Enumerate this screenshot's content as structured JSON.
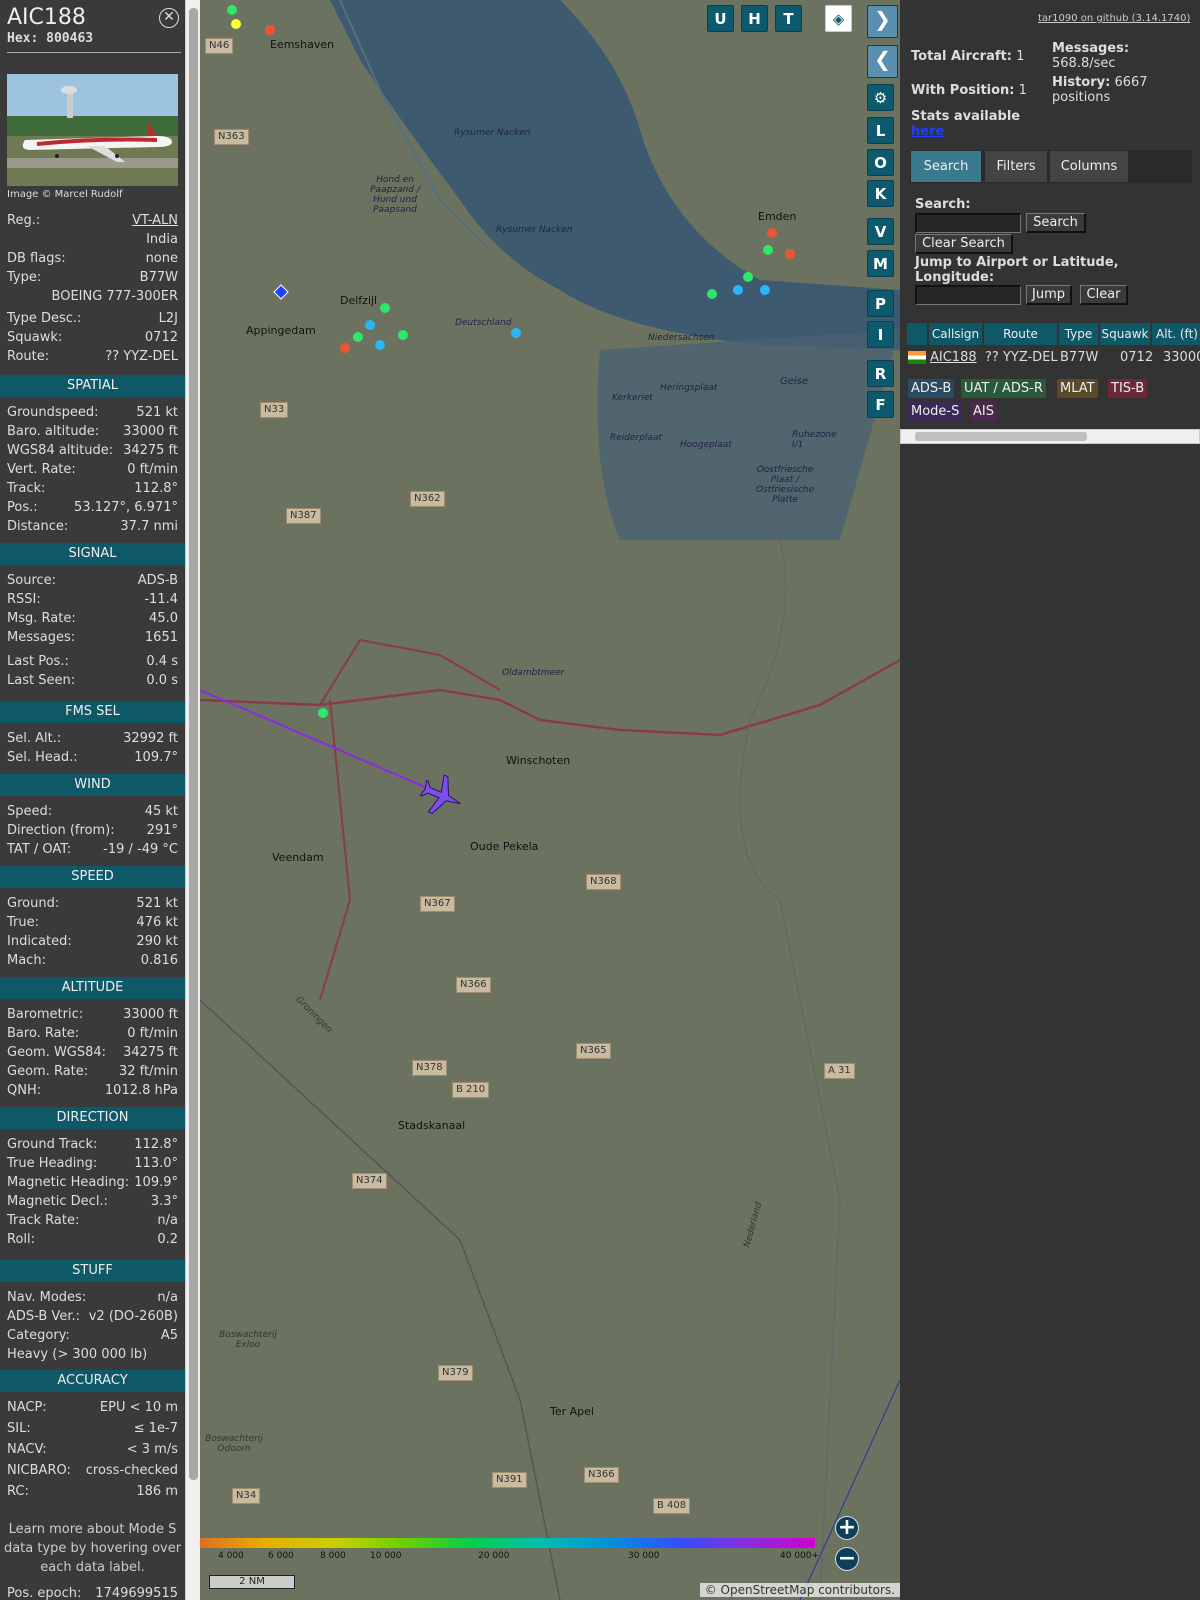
{
  "aircraft": {
    "callsign": "AIC188",
    "hex_label": "Hex:",
    "hex": "800463",
    "photo_credit": "Image © Marcel Rudolf",
    "close_icon": "close-icon"
  },
  "info": [
    {
      "k": "Reg.:",
      "v": "VT-ALN",
      "link": true
    },
    {
      "k": "",
      "v": "India"
    },
    {
      "k": "DB flags:",
      "v": "none"
    },
    {
      "k": "Type:",
      "v": "B77W"
    },
    {
      "k": "",
      "v": "BOEING 777-300ER"
    },
    {
      "k": "Type Desc.:",
      "v": "L2J"
    },
    {
      "k": "Squawk:",
      "v": "0712"
    },
    {
      "k": "Route:",
      "v": "?? YYZ-DEL"
    }
  ],
  "sections": [
    {
      "title": "SPATIAL",
      "rows": [
        [
          "Groundspeed:",
          "521 kt"
        ],
        [
          "Baro. altitude:",
          "33000 ft"
        ],
        [
          "WGS84 altitude:",
          "34275 ft"
        ],
        [
          "Vert. Rate:",
          "0 ft/min"
        ],
        [
          "Track:",
          "112.8°"
        ],
        [
          "Pos.:",
          "53.127°, 6.971°"
        ],
        [
          "Distance:",
          "37.7 nmi"
        ]
      ]
    },
    {
      "title": "SIGNAL",
      "rows": [
        [
          "Source:",
          "ADS-B"
        ],
        [
          "RSSI:",
          "-11.4"
        ],
        [
          "Msg. Rate:",
          "45.0"
        ],
        [
          "Messages:",
          "1651"
        ],
        [
          "Last Pos.:",
          "0.4 s"
        ],
        [
          "Last Seen:",
          "0.0 s"
        ]
      ]
    },
    {
      "title": "FMS SEL",
      "rows": [
        [
          "Sel. Alt.:",
          "32992 ft"
        ],
        [
          "Sel. Head.:",
          "109.7°"
        ]
      ]
    },
    {
      "title": "WIND",
      "rows": [
        [
          "Speed:",
          "45 kt"
        ],
        [
          "Direction (from):",
          "291°"
        ],
        [
          "TAT / OAT:",
          "-19 / -49 °C"
        ]
      ]
    },
    {
      "title": "SPEED",
      "rows": [
        [
          "Ground:",
          "521 kt"
        ],
        [
          "True:",
          "476 kt"
        ],
        [
          "Indicated:",
          "290 kt"
        ],
        [
          "Mach:",
          "0.816"
        ]
      ]
    },
    {
      "title": "ALTITUDE",
      "rows": [
        [
          "Barometric:",
          "33000 ft"
        ],
        [
          "Baro. Rate:",
          "0 ft/min"
        ],
        [
          "Geom. WGS84:",
          "34275 ft"
        ],
        [
          "Geom. Rate:",
          "32 ft/min"
        ],
        [
          "QNH:",
          "1012.8 hPa"
        ]
      ]
    },
    {
      "title": "DIRECTION",
      "rows": [
        [
          "Ground Track:",
          "112.8°"
        ],
        [
          "True Heading:",
          "113.0°"
        ],
        [
          "Magnetic Heading:",
          "109.9°"
        ],
        [
          "Magnetic Decl.:",
          "3.3°"
        ],
        [
          "Track Rate:",
          "n/a"
        ],
        [
          "Roll:",
          "0.2"
        ]
      ]
    },
    {
      "title": "STUFF",
      "rows": [
        [
          "Nav. Modes:",
          "n/a"
        ],
        [
          "ADS-B Ver.:",
          "v2 (DO-260B)"
        ],
        [
          "Category:",
          "A5"
        ],
        [
          "Heavy (> 300 000 lb)",
          ""
        ]
      ]
    },
    {
      "title": "ACCURACY",
      "rows": [
        [
          "NACP:",
          "EPU < 10 m"
        ],
        [
          "SIL:",
          "≤ 1e-7"
        ],
        [
          "NACV:",
          "< 3 m/s"
        ],
        [
          "NICBARO:",
          "cross-checked"
        ],
        [
          "RC:",
          "186 m"
        ]
      ]
    }
  ],
  "note": "Learn more about Mode S data type by hovering over each data label.",
  "epoch": {
    "k": "Pos. epoch:",
    "v": "1749699515"
  },
  "map_buttons": [
    "U",
    "H",
    "T"
  ],
  "map_side_buttons": [
    "L",
    "O",
    "K",
    "V",
    "M",
    "P",
    "I",
    "R",
    "F"
  ],
  "map_labels": {
    "emshaven": "Eemshaven",
    "delfzijl": "Delfzijl",
    "appingedam": "Appingedam",
    "emden": "Emden",
    "winschoten": "Winschoten",
    "oudepekela": "Oude Pekela",
    "veendam": "Veendam",
    "stadskanaal": "Stadskanaal",
    "terapel": "Ter Apel",
    "oldambtmeer": "Oldambtmeer",
    "rysumer": "Rysumer Nacken",
    "hond": "Hond en Paapzand / Hund und Paapsand",
    "rysumer2": "Rysumer Nacken",
    "deutschland": "Deutschland",
    "niedersachsen": "Niedersachsen",
    "heringsplaat": "Heringsplaat",
    "kerkeriet": "Kerkeriet",
    "reiderplaat": "Reiderplaat",
    "hoogeplaat": "Hoogeplaat",
    "oostfriesche": "Oostfriesche Plaat / Ostfriesische Platte",
    "geise": "Geise",
    "ruhezone": "Ruhezone I/1",
    "groningen": "Groningen",
    "nederland": "Nederland",
    "boswachterij1": "Boswachterij Exloo",
    "boswachterij2": "Boswachterij Odoorn"
  },
  "roads": [
    "N46",
    "N363",
    "N33",
    "N387",
    "N362",
    "N367",
    "N368",
    "N366",
    "N365",
    "N378",
    "N374",
    "N379",
    "N391",
    "N366",
    "N34",
    "B 210",
    "B 408",
    "A 31"
  ],
  "color_scale": {
    "labels": [
      "4 000",
      "6 000",
      "8 000",
      "10 000",
      "20 000",
      "30 000",
      "40 000+"
    ],
    "scale": "2 NM"
  },
  "attribution": "© OpenStreetMap contributors.",
  "right": {
    "github": "tar1090 on github (3.14.1740)",
    "total_label": "Total Aircraft:",
    "total": "1",
    "withpos_label": "With Position:",
    "withpos": "1",
    "stats_label": "Stats available",
    "stats_link": "here",
    "msgs_label": "Messages:",
    "msgs": "568.8/sec",
    "hist_label": "History:",
    "hist": "6667 positions",
    "tabs": [
      "Search",
      "Filters",
      "Columns"
    ],
    "search_label": "Search:",
    "search_btn": "Search",
    "clear_search": "Clear Search",
    "jump_label": "Jump to Airport or Latitude, Longitude:",
    "jump_btn": "Jump",
    "clear_btn": "Clear",
    "cols": [
      "Callsign",
      "Route",
      "Type",
      "Squawk",
      "Alt. (ft)"
    ],
    "row": {
      "callsign": "AIC188",
      "route": "?? YYZ-DEL",
      "type": "B77W",
      "squawk": "0712",
      "alt": "33000"
    },
    "badges": [
      "ADS-B",
      "UAT / ADS-R",
      "MLAT",
      "TIS-B",
      "Mode-S",
      "AIS"
    ]
  }
}
